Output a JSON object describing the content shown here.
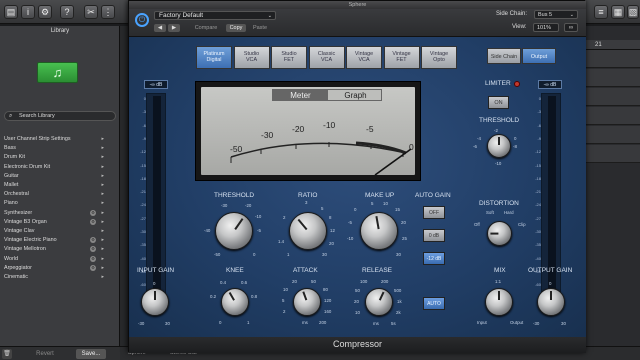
{
  "daw": {
    "library_title": "Library",
    "search_placeholder": "Search Library",
    "library_items": [
      {
        "label": "User Channel Strip Settings",
        "gear": false
      },
      {
        "label": "Bass",
        "gear": false
      },
      {
        "label": "Drum Kit",
        "gear": false
      },
      {
        "label": "Electronic Drum Kit",
        "gear": false
      },
      {
        "label": "Guitar",
        "gear": false
      },
      {
        "label": "Mallet",
        "gear": false
      },
      {
        "label": "Orchestral",
        "gear": false
      },
      {
        "label": "Piano",
        "gear": false
      },
      {
        "label": "Synthesizer",
        "gear": true
      },
      {
        "label": "Vintage B3 Organ",
        "gear": true
      },
      {
        "label": "Vintage Clav",
        "gear": false
      },
      {
        "label": "Vintage Electric Piano",
        "gear": true
      },
      {
        "label": "Vintage Mellotron",
        "gear": true
      },
      {
        "label": "World",
        "gear": true
      },
      {
        "label": "Arpeggiator",
        "gear": true
      },
      {
        "label": "Cinematic",
        "gear": false
      }
    ],
    "revert_label": "Revert",
    "save_label": "Save...",
    "bottom_labels": [
      "Sphere",
      "Stereo Out"
    ],
    "ruler_marker": "21",
    "track_rows": 6
  },
  "plugin": {
    "window_title": "Sphere",
    "preset": "Factory Default",
    "compare_label": "Compare",
    "copy_label": "Copy",
    "paste_label": "Paste",
    "side_chain_label": "Side Chain:",
    "side_chain_value": "Bus 5",
    "view_label": "View:",
    "view_value": "101%",
    "models": [
      {
        "label": "Platinum\nDigital",
        "active": true
      },
      {
        "label": "Studio\nVCA",
        "active": false
      },
      {
        "label": "Studio\nFET",
        "active": false
      },
      {
        "label": "Classic\nVCA",
        "active": false
      },
      {
        "label": "Vintage\nVCA",
        "active": false
      },
      {
        "label": "Vintage\nFET",
        "active": false
      },
      {
        "label": "Vintage\nOpto",
        "active": false
      }
    ],
    "side_chain_btn": "Side Chain",
    "output_btn": "Output",
    "meter_tab": "Meter",
    "graph_tab": "Graph",
    "meter_scale": [
      "-50",
      "-30",
      "-20",
      "-10",
      "-5",
      "0"
    ],
    "input_peak": "-∞ dB",
    "output_peak": "-∞ dB",
    "vmeter_ticks": [
      "0",
      "-3",
      "-6",
      "-9",
      "-12",
      "-15",
      "-18",
      "-21",
      "-24",
      "-27",
      "-30",
      "-35",
      "-40",
      "-50",
      "-60"
    ],
    "limiter_label": "LIMITER",
    "limiter_on": "ON",
    "threshold_right_label": "THRESHOLD",
    "threshold_right_ticks": [
      "-4",
      "-2",
      "0",
      "-6",
      "-8",
      "-10",
      "10"
    ],
    "distortion_label": "DISTORTION",
    "distortion_ticks": [
      "Soft",
      "Hard",
      "Off",
      "Clip"
    ],
    "mix_label": "MIX",
    "mix_ticks": [
      "1:1",
      "Input",
      "Output"
    ],
    "output_gain_label": "OUTPUT GAIN",
    "output_gain_ticks": [
      "0",
      "-30",
      "30"
    ],
    "threshold_label": "THRESHOLD",
    "threshold_ticks": [
      "-30",
      "-20",
      "-10",
      "-40",
      "-5",
      "-50",
      "0"
    ],
    "ratio_label": "RATIO",
    "ratio_ticks": [
      "3",
      "5",
      "8",
      "2",
      "12",
      "1.4",
      "20",
      "1",
      "30"
    ],
    "makeup_label": "MAKE UP",
    "makeup_ticks": [
      "5",
      "10",
      "15",
      "0",
      "20",
      "-5",
      "25",
      "-10",
      "30"
    ],
    "auto_gain_label": "AUTO GAIN",
    "auto_gain_buttons": [
      {
        "label": "OFF",
        "blue": false
      },
      {
        "label": "0 dB",
        "blue": false
      },
      {
        "label": "-12 dB",
        "blue": true
      }
    ],
    "input_gain_label": "INPUT GAIN",
    "input_gain_ticks": [
      "0",
      "-30",
      "30"
    ],
    "knee_label": "KNEE",
    "knee_ticks": [
      "0.4",
      "0.6",
      "0.2",
      "0.8",
      "0",
      "1"
    ],
    "attack_label": "ATTACK",
    "attack_ticks": [
      "20",
      "50",
      "10",
      "80",
      "5",
      "120",
      "2",
      "160",
      "ms",
      "200"
    ],
    "release_label": "RELEASE",
    "release_ticks": [
      "100",
      "200",
      "50",
      "500",
      "20",
      "1k",
      "10",
      "2k",
      "ms",
      "5s"
    ],
    "auto_btn": "AUTO",
    "footer": "Compressor"
  },
  "colors": {
    "accent": "#4aa3ff",
    "panel_blue": "#213e66",
    "model_active": "#3d6fb3",
    "lib_icon": "#3fae48"
  }
}
